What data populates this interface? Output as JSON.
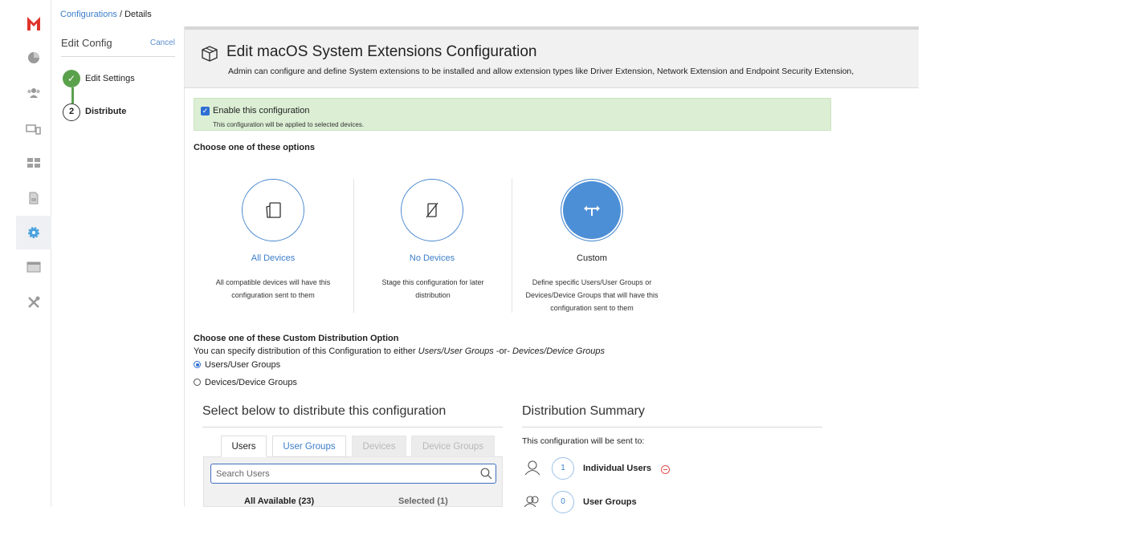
{
  "breadcrumb": {
    "parent": "Configurations",
    "separator": " / ",
    "current": "Details"
  },
  "steps_panel": {
    "title": "Edit Config",
    "cancel": "Cancel",
    "step1_label": "Edit Settings",
    "step2_number": "2",
    "step2_label": "Distribute"
  },
  "header": {
    "title": "Edit macOS System Extensions Configuration",
    "subtitle": "Admin can configure and define System extensions to be installed and allow extension types like Driver Extension, Network Extension and Endpoint Security Extension,"
  },
  "enable": {
    "label": "Enable this configuration",
    "note": "This configuration will be applied to selected devices.",
    "checked": true
  },
  "options": {
    "heading": "Choose one of these options",
    "all_devices": {
      "title": "All Devices",
      "desc1": "All compatible devices will have this",
      "desc2": "configuration sent to them"
    },
    "no_devices": {
      "title": "No Devices",
      "desc1": "Stage this configuration for later",
      "desc2": "distribution"
    },
    "custom": {
      "title": "Custom",
      "desc1": "Define specific Users/User Groups or",
      "desc2": "Devices/Device Groups that will have this",
      "desc3": "configuration sent to them",
      "selected": true
    }
  },
  "custom_distribution": {
    "heading": "Choose one of these Custom Distribution Option",
    "desc_prefix": "You can specify distribution of this Configuration to either ",
    "desc_em1": "Users/User Groups",
    "desc_mid": " -or- ",
    "desc_em2": "Devices/Device Groups",
    "radio_users": "Users/User Groups",
    "radio_devices": "Devices/Device Groups",
    "selected": "Users/User Groups"
  },
  "select_section": {
    "title": "Select below to distribute this configuration",
    "tabs": [
      "Users",
      "User Groups",
      "Devices",
      "Device Groups"
    ],
    "search_placeholder": "Search Users",
    "all_available": "All Available (23)",
    "selected": "Selected (1)"
  },
  "summary": {
    "title": "Distribution Summary",
    "intro": "This configuration will be sent to:",
    "individual_users_count": "1",
    "individual_users_label": "Individual Users",
    "user_groups_count": "0",
    "user_groups_label": "User Groups"
  },
  "colors": {
    "accent": "#3b7ec9",
    "success": "#5aa14b",
    "enable_bg": "#dcefd5",
    "brand": "#e0332a"
  }
}
